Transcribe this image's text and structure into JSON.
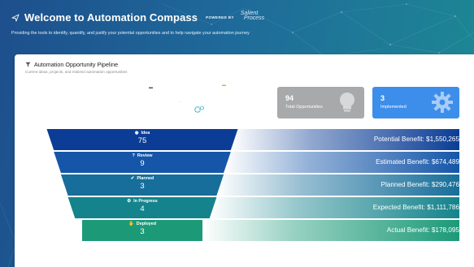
{
  "header": {
    "title": "Welcome to Automation Compass",
    "powered_by": "POWERED BY",
    "logo_line1": "Salient",
    "logo_line2": "Process",
    "subtitle": "Providing the tools to identify, quantify, and justify your potential opportunities and to help navigate your automation journey"
  },
  "card": {
    "title": "Automation Opportunity Pipeline",
    "subtitle": "Current ideas, projects, and realized automation opportunities"
  },
  "stats": {
    "total": {
      "value": "94",
      "label": "Total Opportunities",
      "icon": "lightbulb-icon"
    },
    "implemented": {
      "value": "3",
      "label": "Implemented",
      "icon": "gear-icon"
    }
  },
  "stages": [
    {
      "label": "Idea",
      "count": "75",
      "icon": "lightbulb-icon",
      "color": "#0b3d96",
      "benefit": "Potential Benefit: $1,550,265"
    },
    {
      "label": "Review",
      "count": "9",
      "icon": "question-icon",
      "color": "#1556a9",
      "benefit": "Estimated Benefit: $674,489"
    },
    {
      "label": "Planned",
      "count": "3",
      "icon": "check-icon",
      "color": "#176e9a",
      "benefit": "Planned Benefit: $290,476"
    },
    {
      "label": "In Progress",
      "count": "4",
      "icon": "gears-icon",
      "color": "#14838c",
      "benefit": "Expected Benefit: $1,111,786"
    },
    {
      "label": "Deployed",
      "count": "3",
      "icon": "thumbs-up-icon",
      "color": "#1c9a78",
      "benefit": "Actual Benefit: $178,095"
    }
  ],
  "colors": {
    "accent": "#3d8eea",
    "neutral_card": "#a7a9ab"
  }
}
